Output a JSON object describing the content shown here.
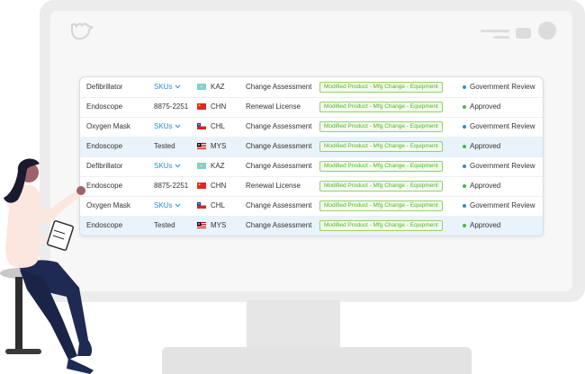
{
  "colors": {
    "link": "#2a8fd6",
    "tag_green": "#56b32a",
    "dot_blue": "#2a8fd6",
    "dot_green": "#4bb543",
    "highlight": "#e8f3fc"
  },
  "icons": {
    "logo": "bird-logo-icon",
    "chevron": "chevron-down-icon"
  },
  "rows": [
    {
      "product": "Defibrillator",
      "sku": "SKUs",
      "sku_is_link": true,
      "flag": "kaz",
      "country": "KAZ",
      "type": "Change Assessment",
      "tag": "Modified Product - Mfg Change - Equipment",
      "status": "Government Review",
      "status_color": "blue",
      "highlight": false
    },
    {
      "product": "Endoscope",
      "sku": "8875-2251",
      "sku_is_link": false,
      "flag": "chn",
      "country": "CHN",
      "type": "Renewal License",
      "tag": "Modified Product - Mfg Change - Equipment",
      "status": "Approved",
      "status_color": "green",
      "highlight": false
    },
    {
      "product": "Oxygen Mask",
      "sku": "SKUs",
      "sku_is_link": true,
      "flag": "chl",
      "country": "CHL",
      "type": "Change Assessment",
      "tag": "Modified Product - Mfg Change - Equipment",
      "status": "Government Review",
      "status_color": "blue",
      "highlight": false
    },
    {
      "product": "Endoscope",
      "sku": "Tested",
      "sku_is_link": false,
      "flag": "mys",
      "country": "MYS",
      "type": "Change Assessment",
      "tag": "Modified Product - Mfg Change - Equipment",
      "status": "Approved",
      "status_color": "green",
      "highlight": true
    },
    {
      "product": "Defibrillator",
      "sku": "SKUs",
      "sku_is_link": true,
      "flag": "kaz",
      "country": "KAZ",
      "type": "Change Assessment",
      "tag": "Modified Product - Mfg Change - Equipment",
      "status": "Government Review",
      "status_color": "blue",
      "highlight": false
    },
    {
      "product": "Endoscope",
      "sku": "8875-2251",
      "sku_is_link": false,
      "flag": "chn",
      "country": "CHN",
      "type": "Renewal License",
      "tag": "Modified Product - Mfg Change - Equipment",
      "status": "Approved",
      "status_color": "green",
      "highlight": false
    },
    {
      "product": "Oxygen Mask",
      "sku": "SKUs",
      "sku_is_link": true,
      "flag": "chl",
      "country": "CHL",
      "type": "Change Assessment",
      "tag": "Modified Product - Mfg Change - Equipment",
      "status": "Government Review",
      "status_color": "blue",
      "highlight": false
    },
    {
      "product": "Endoscope",
      "sku": "Tested",
      "sku_is_link": false,
      "flag": "mys",
      "country": "MYS",
      "type": "Change Assessment",
      "tag": "Modified Product - Mfg Change - Equipment",
      "status": "Approved",
      "status_color": "green",
      "highlight": true
    }
  ]
}
